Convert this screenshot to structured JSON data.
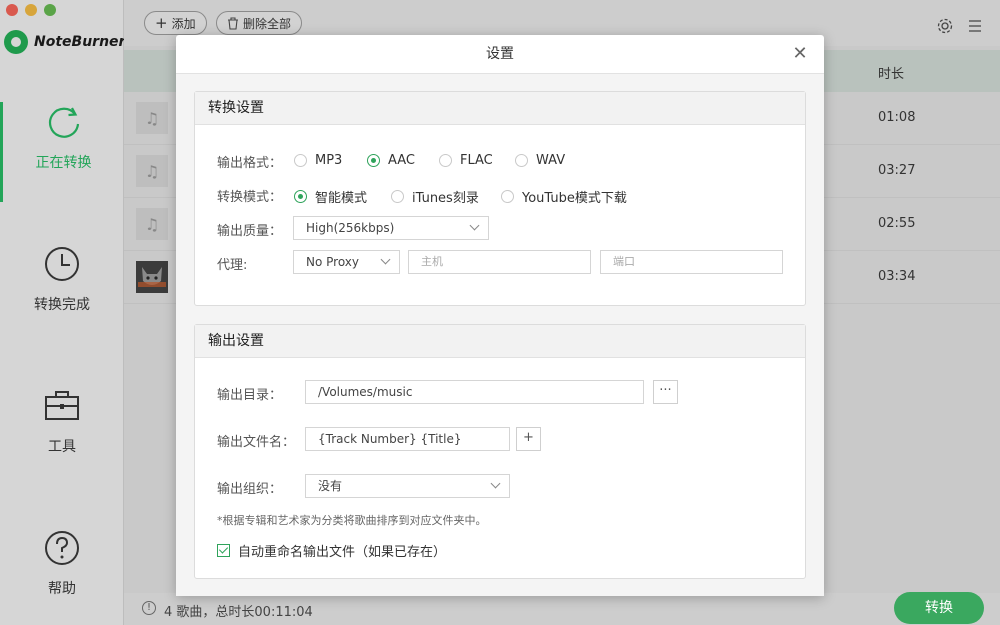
{
  "app": {
    "brand_name": "NoteBurner",
    "accent_color": "#23a559",
    "nav": [
      {
        "label": "正在转换",
        "icon": "refresh-icon",
        "active": true
      },
      {
        "label": "转换完成",
        "icon": "clock-icon",
        "active": false
      },
      {
        "label": "工具",
        "icon": "toolbox-icon",
        "active": false
      },
      {
        "label": "帮助",
        "icon": "help-icon",
        "active": false
      }
    ],
    "toolbar": {
      "add_label": "添加",
      "delete_all_label": "删除全部"
    },
    "list": {
      "duration_header": "时长",
      "rows": [
        {
          "duration": "01:08",
          "thumb": "music-note-icon"
        },
        {
          "duration": "03:27",
          "thumb": "music-note-icon"
        },
        {
          "duration": "02:55",
          "thumb": "music-note-icon"
        },
        {
          "duration": "03:34",
          "thumb": "album-art"
        }
      ]
    },
    "status": {
      "summary": "4 歌曲，总时长00:11:04",
      "convert_label": "转换"
    }
  },
  "modal": {
    "title": "设置",
    "conversion": {
      "section_title": "转换设置",
      "format_label": "输出格式：",
      "formats": [
        {
          "label": "MP3",
          "selected": false
        },
        {
          "label": "AAC",
          "selected": true
        },
        {
          "label": "FLAC",
          "selected": false
        },
        {
          "label": "WAV",
          "selected": false
        }
      ],
      "mode_label": "转换模式：",
      "modes": [
        {
          "label": "智能模式",
          "selected": true
        },
        {
          "label": "iTunes刻录",
          "selected": false
        },
        {
          "label": "YouTube模式下载",
          "selected": false
        }
      ],
      "quality_label": "输出质量：",
      "quality_value": "High(256kbps)",
      "proxy_label": "代理:",
      "proxy_value": "No Proxy",
      "host_placeholder": "主机",
      "port_placeholder": "端口"
    },
    "output": {
      "section_title": "输出设置",
      "dir_label": "输出目录：",
      "dir_value": "/Volumes/music",
      "browse_label": "···",
      "filename_label": "输出文件名：",
      "filename_value": "{Track Number} {Title}",
      "add_label": "+",
      "organize_label": "输出组织：",
      "organize_value": "没有",
      "note": "*根据专辑和艺术家为分类将歌曲排序到对应文件夹中。",
      "rename_label": "自动重命名输出文件（如果已存在）",
      "rename_checked": true
    }
  }
}
